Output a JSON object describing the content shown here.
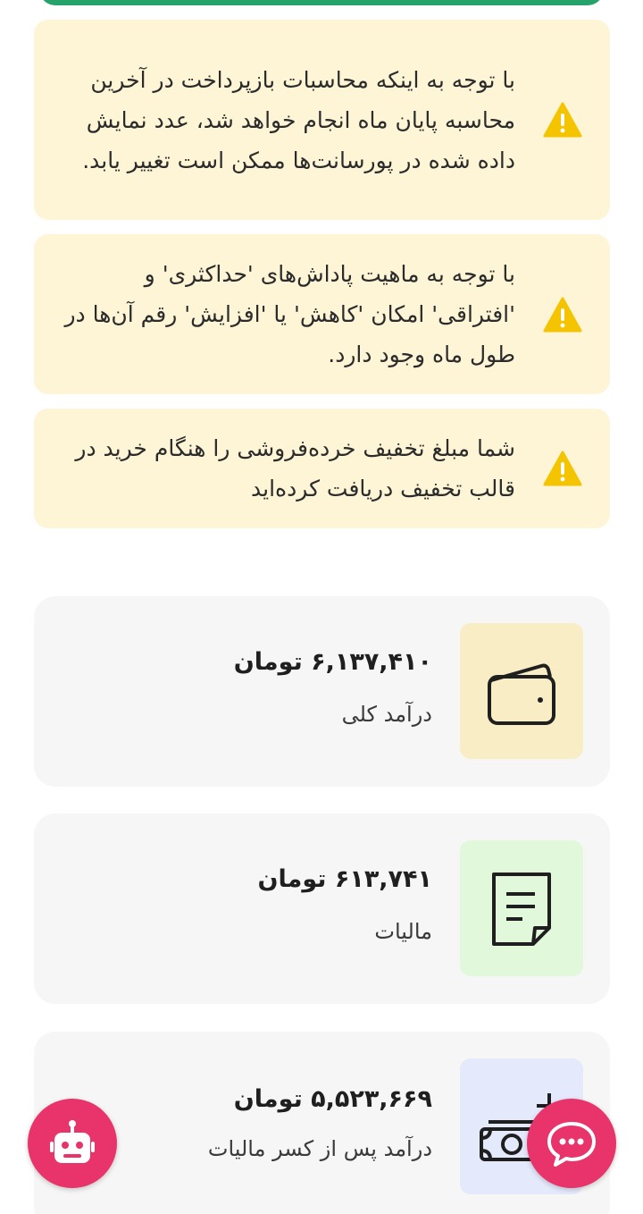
{
  "alerts": [
    {
      "text": "با توجه به اینکه محاسبات بازپرداخت در آخرین محاسبه پایان ماه انجام خواهد شد، عدد نمایش داده شده در پورسانت‌ها ممکن است تغییر یابد.",
      "icon": "warning-icon"
    },
    {
      "text": "با توجه به ماهیت پاداش‌های 'حداکثری' و 'افتراقی' امکان 'کاهش' یا 'افزایش' رقم آن‌ها در طول ماه وجود دارد.",
      "icon": "warning-icon"
    },
    {
      "text": "شما مبلغ تخفیف خرده‌فروشی را هنگام خرید در قالب تخفیف دریافت کرده‌اید",
      "icon": "warning-icon"
    }
  ],
  "cards": {
    "income": {
      "amount": "۶,۱۳۷,۴۱۰ تومان",
      "label": "درآمد کلی",
      "icon": "wallet-icon",
      "bg": "#f8edc4"
    },
    "tax": {
      "amount": "۶۱۳,۷۴۱ تومان",
      "label": "مالیات",
      "icon": "document-icon",
      "bg": "#e2f8da"
    },
    "net": {
      "amount": "۵,۵۲۳,۶۶۹ تومان",
      "label": "درآمد پس از کسر مالیات",
      "icon": "money-plus-icon",
      "bg": "#e4e9fb"
    }
  },
  "colors": {
    "warning": "#f4c400",
    "alert_bg": "#fdf5d6",
    "fab": "#e8336b",
    "top_bar": "#25a36a"
  },
  "fabs": {
    "left": "robot-icon",
    "right": "chat-icon"
  }
}
